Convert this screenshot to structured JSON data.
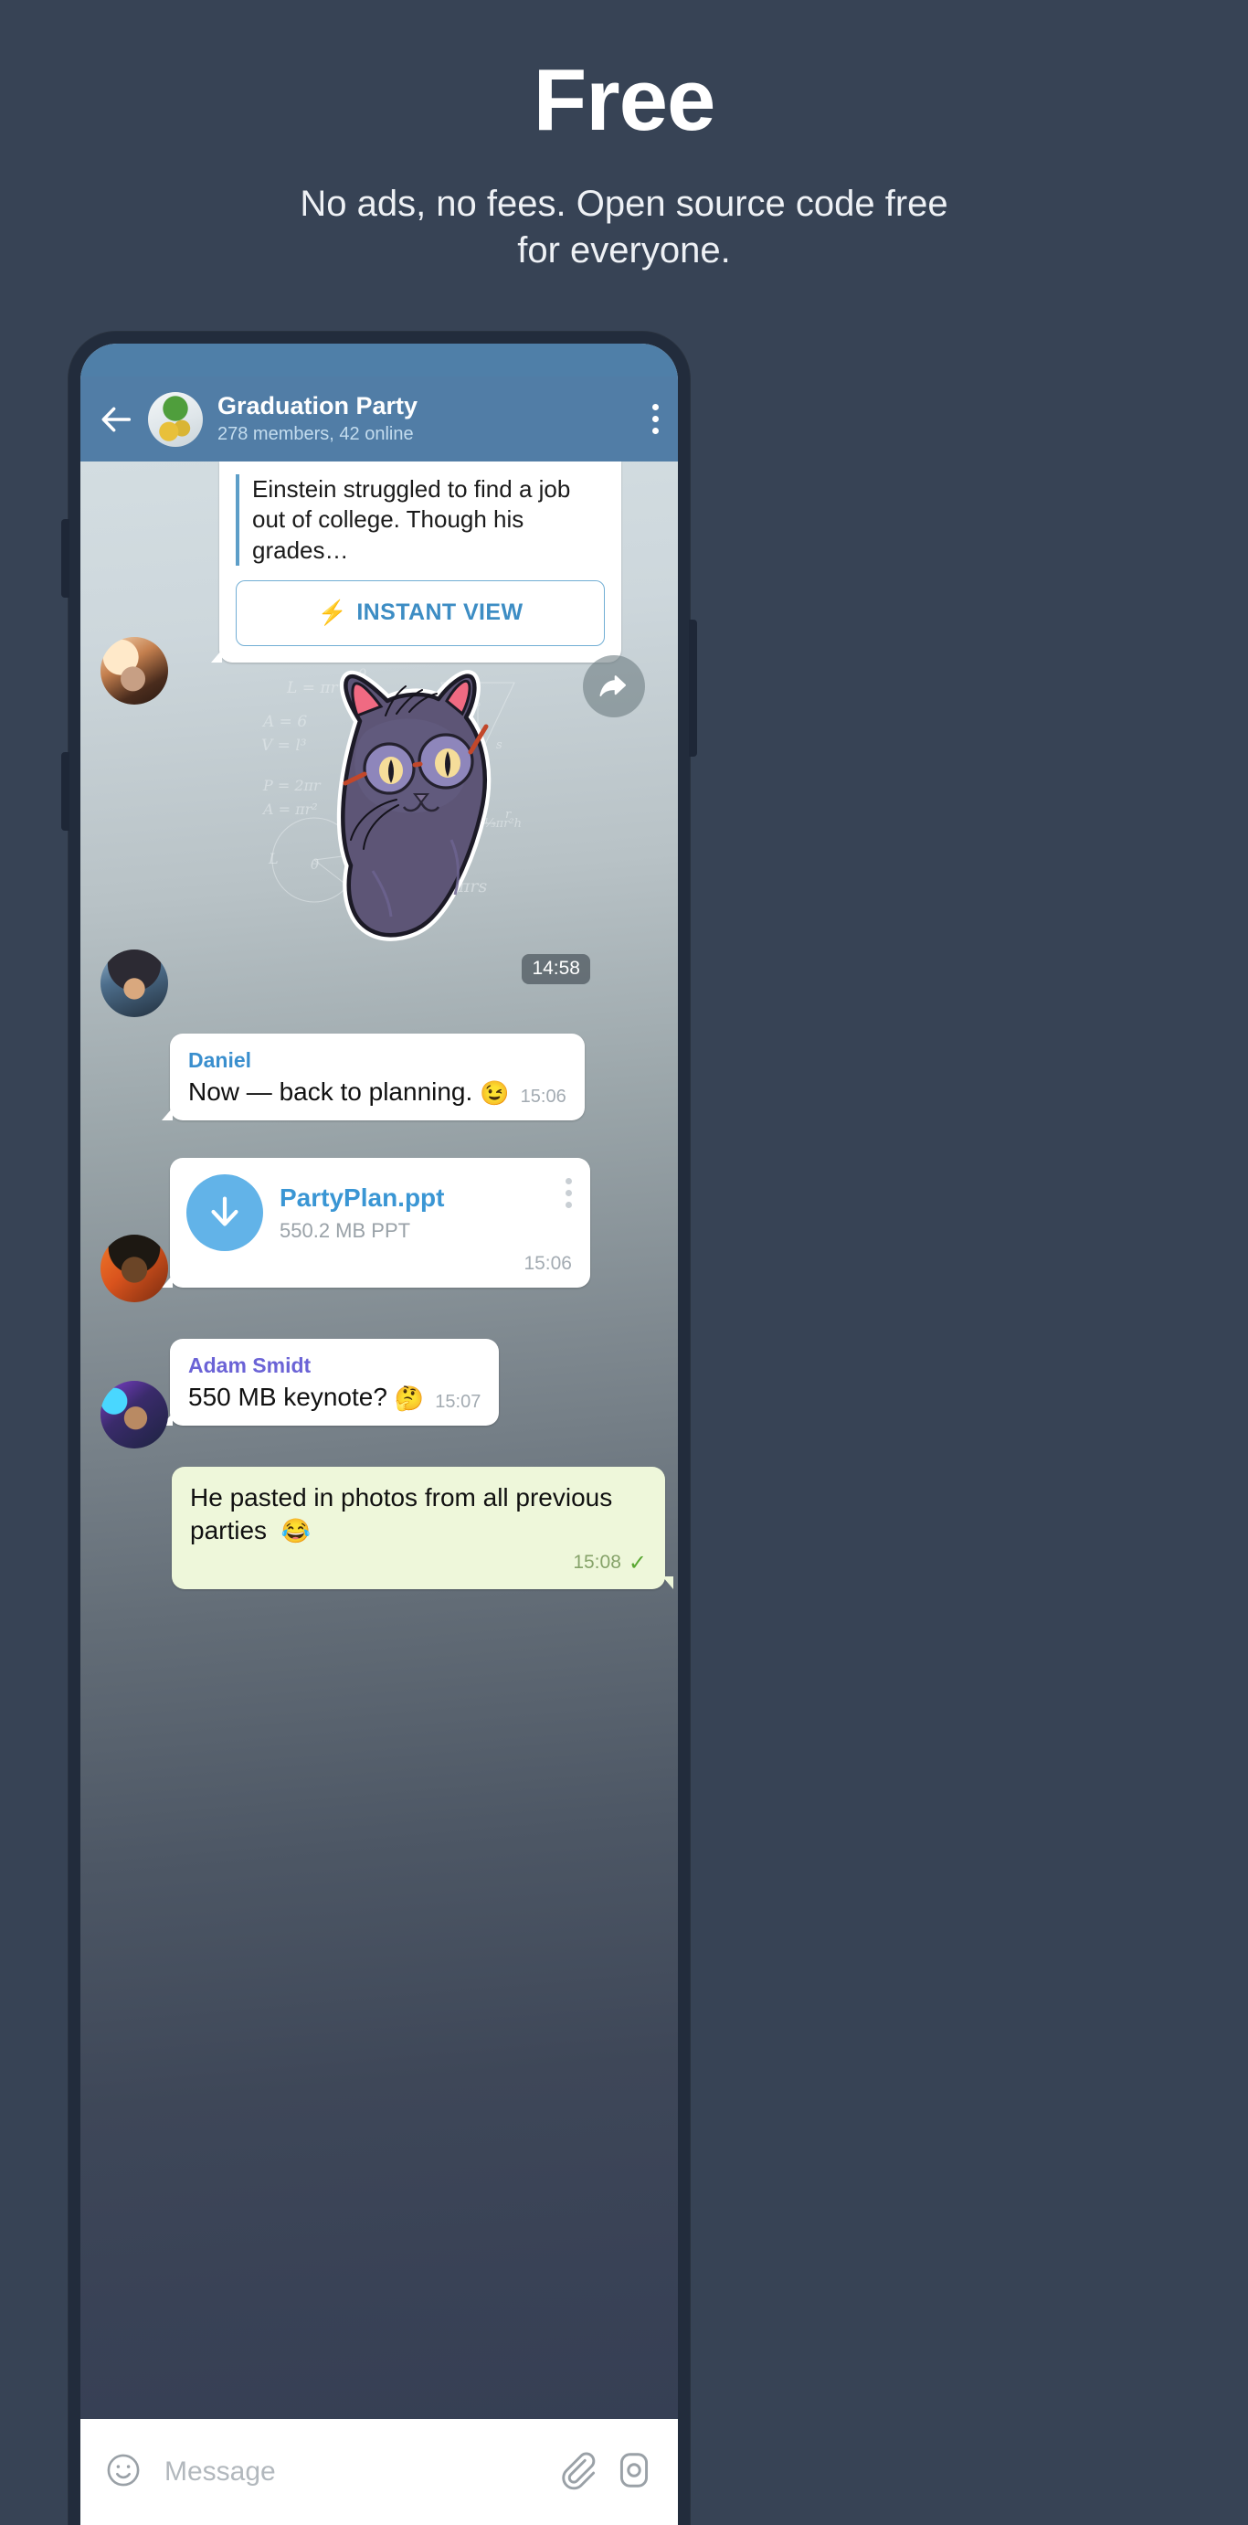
{
  "promo": {
    "title": "Free",
    "subtitle": "No ads, no fees. Open source code free for everyone."
  },
  "colors": {
    "page_background": "#374355",
    "header_blue": "#517da6",
    "statusbar_blue": "#4f7fa8",
    "accent_link": "#3a8fce",
    "outgoing_bubble": "#eef7da",
    "phone_bezel": "#222c3c",
    "download_circle": "#62b3e8",
    "check_green": "#5aa832"
  },
  "chat": {
    "header": {
      "back_icon": "arrow-left-icon",
      "avatar_icon": "group-avatar",
      "title": "Graduation Party",
      "subtitle": "278 members, 42 online",
      "menu_icon": "more-vertical-icon"
    },
    "messages": [
      {
        "type": "link_preview",
        "sender_avatar": "avatar-woman-smiling",
        "preview_text": "Einstein struggled to find a job out of college. Though his grades…",
        "button_label": "INSTANT VIEW",
        "button_icon": "lightning-bolt-icon",
        "share_icon": "share-forward-icon"
      },
      {
        "type": "sticker",
        "sender_avatar": "avatar-person-hoodie",
        "sticker_name": "math-cat-sticker",
        "time": "14:58",
        "sticker_formulas": [
          "L = πr",
          "A = 6",
          "V = l³",
          "P = 2πr",
          "A = πr²",
          "s = √(r² + h²)",
          "A = πr² + πrs",
          "θ",
          "L",
          "h",
          "s",
          "⅓πr²h"
        ]
      },
      {
        "type": "text",
        "sender_name": "Daniel",
        "text": "Now — back to planning.",
        "emoji": "😉",
        "time": "15:06"
      },
      {
        "type": "file",
        "sender_avatar": "avatar-man-sunglasses",
        "file_name": "PartyPlan.ppt",
        "file_meta": "550.2 MB PPT",
        "time": "15:06",
        "download_icon": "download-arrow-icon",
        "menu_icon": "more-vertical-icon"
      },
      {
        "type": "text",
        "sender_name": "Adam Smidt",
        "sender_avatar": "avatar-man-beanie",
        "text": "550 MB keynote?",
        "emoji": "🤔",
        "time": "15:07"
      },
      {
        "type": "outgoing",
        "text": "He pasted in photos from all previous parties",
        "emoji": "😂",
        "time": "15:08",
        "status_icon": "single-check-icon"
      }
    ],
    "input_bar": {
      "emoji_icon": "smiley-icon",
      "placeholder": "Message",
      "attach_icon": "paperclip-icon",
      "camera_icon": "camera-icon"
    }
  }
}
